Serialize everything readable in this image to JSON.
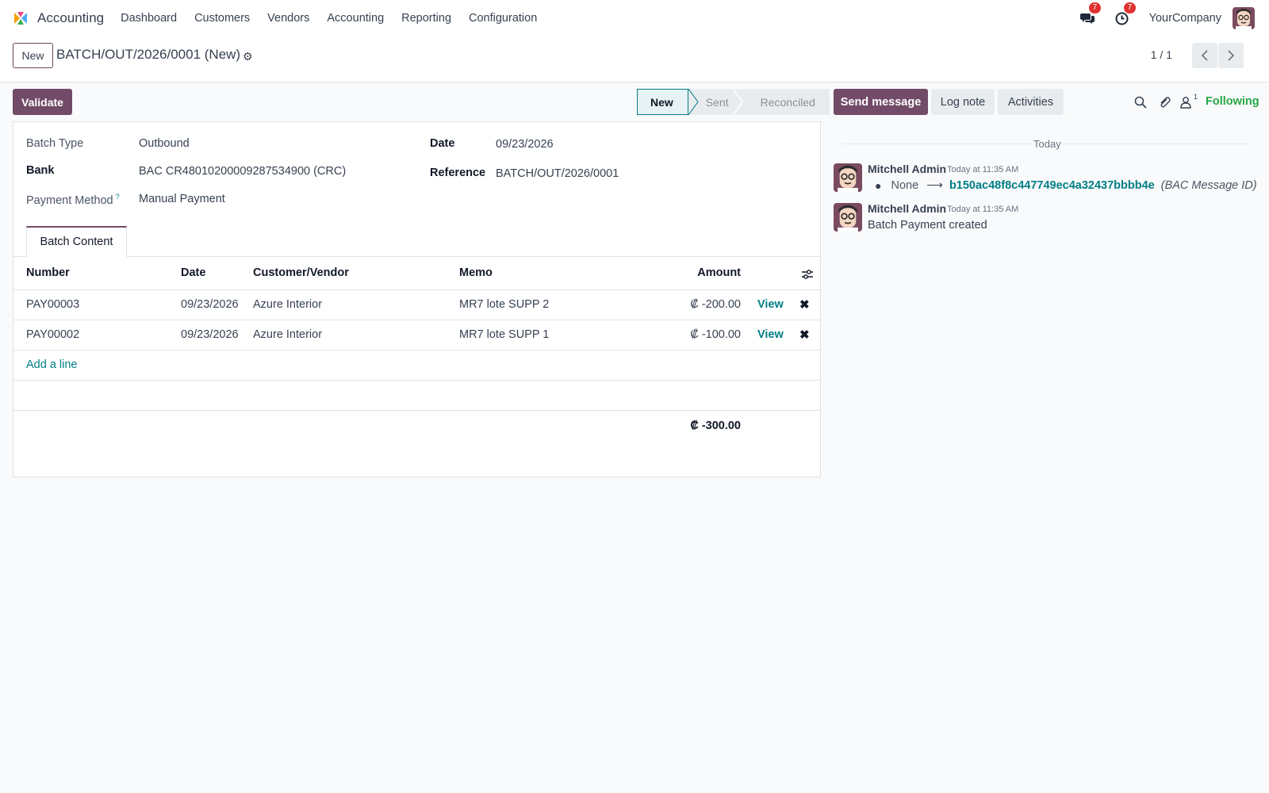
{
  "navbar": {
    "app_name": "Accounting",
    "menu": [
      "Dashboard",
      "Customers",
      "Vendors",
      "Accounting",
      "Reporting",
      "Configuration"
    ],
    "messages_badge": "7",
    "activities_badge": "7",
    "company": "YourCompany"
  },
  "control": {
    "new_label": "New",
    "record_title": "BATCH/OUT/2026/0001 (New)",
    "pager": "1 / 1"
  },
  "form": {
    "validate_label": "Validate",
    "stages": [
      "New",
      "Sent",
      "Reconciled"
    ],
    "active_stage": "New",
    "fields": {
      "batch_type_label": "Batch Type",
      "batch_type_value": "Outbound",
      "bank_label": "Bank",
      "bank_value": "BAC CR48010200009287534900 (CRC)",
      "payment_method_label": "Payment Method",
      "payment_method_help": "?",
      "payment_method_value": "Manual Payment",
      "date_label": "Date",
      "date_value": "09/23/2026",
      "reference_label": "Reference",
      "reference_value": "BATCH/OUT/2026/0001"
    },
    "tab_label": "Batch Content",
    "table": {
      "headers": [
        "Number",
        "Date",
        "Customer/Vendor",
        "Memo",
        "Amount"
      ],
      "rows": [
        {
          "number": "PAY00003",
          "date": "09/23/2026",
          "partner": "Azure Interior",
          "memo": "MR7 lote SUPP 2",
          "amount": "₡ -200.00",
          "action": "View"
        },
        {
          "number": "PAY00002",
          "date": "09/23/2026",
          "partner": "Azure Interior",
          "memo": "MR7 lote SUPP 1",
          "amount": "₡ -100.00",
          "action": "View"
        }
      ],
      "add_line": "Add a line",
      "total": "₡ -300.00"
    }
  },
  "chatter": {
    "send_message": "Send message",
    "log_note": "Log note",
    "activities": "Activities",
    "follower_count": "1",
    "following": "Following",
    "today": "Today",
    "messages": [
      {
        "author": "Mitchell Admin",
        "date": "Today at 11:35 AM",
        "tracking_old": "None",
        "tracking_new": "b150ac48f8c447749ec4a32437bbbb4e",
        "tracking_field": "(BAC Message ID)"
      },
      {
        "author": "Mitchell Admin",
        "date": "Today at 11:35 AM",
        "body": "Batch Payment created"
      }
    ]
  },
  "colors": {
    "brand": "#714b67",
    "link": "#017e84",
    "following": "#28a745",
    "badge": "#e03131"
  }
}
